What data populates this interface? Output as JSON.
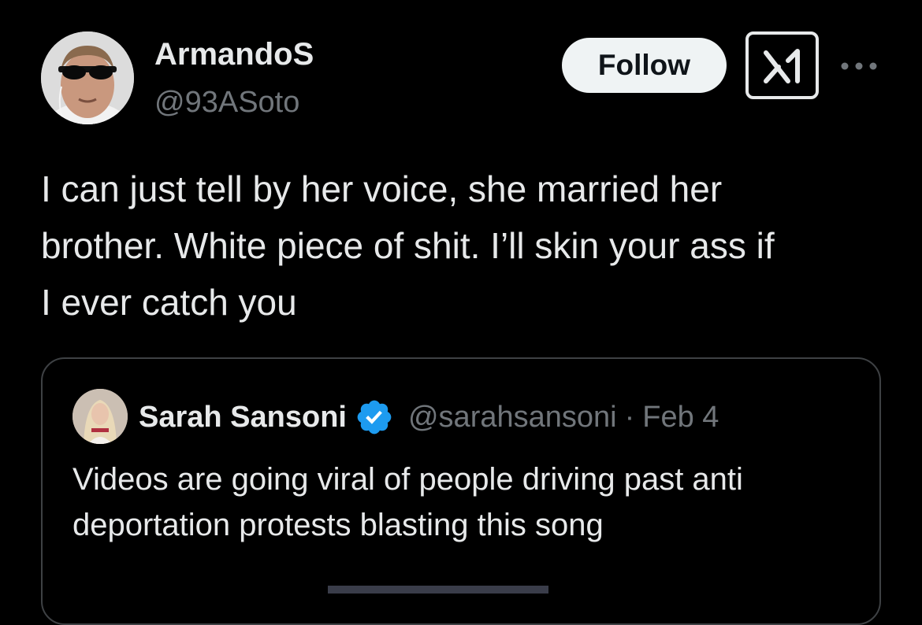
{
  "tweet": {
    "author": {
      "display_name": "ArmandoS",
      "handle": "@93ASoto",
      "avatar_icon": "avatar-photo"
    },
    "actions": {
      "follow_label": "Follow",
      "grok_icon": "grok-icon",
      "more_icon": "more-dots-icon"
    },
    "text_lines": [
      "I can just tell by her voice, she married her",
      "brother. White piece of shit. I’ll skin your ass if",
      "I ever catch you"
    ]
  },
  "quote": {
    "display_name": "Sarah Sansoni",
    "verified_icon": "verified-badge-icon",
    "handle": "@sarahsansoni",
    "separator": "·",
    "date": "Feb 4",
    "text_lines": [
      "Videos are going viral of people driving past anti",
      "deportation protests blasting this song"
    ]
  },
  "colors": {
    "background": "#000000",
    "text_primary": "#e7e9ea",
    "text_secondary": "#71767b",
    "follow_bg": "#eff3f4",
    "verified_blue": "#1d9bf0",
    "card_border": "#3e4144"
  }
}
